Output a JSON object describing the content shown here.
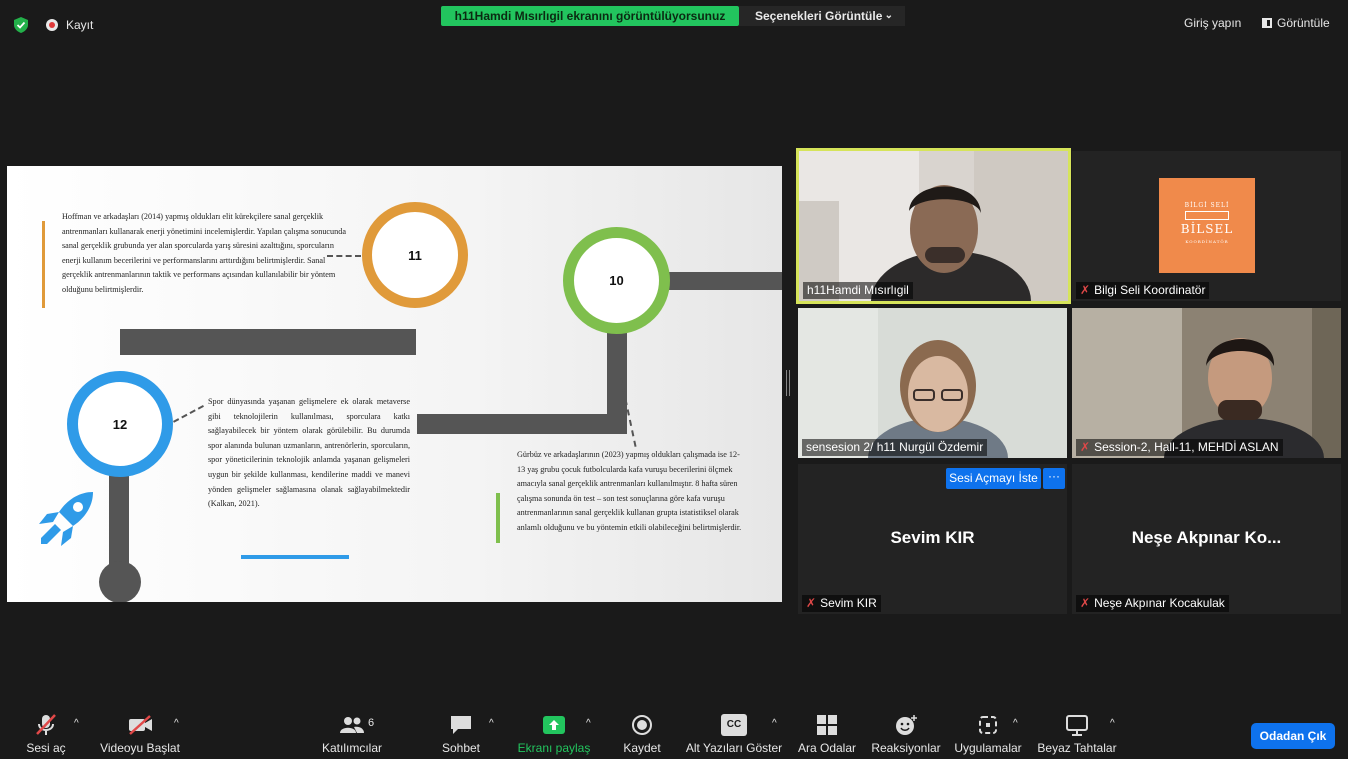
{
  "topbar": {
    "recording_label": "Kayıt",
    "share_banner": "h11Hamdi Mısırlıgil ekranını görüntülüyorsunuz",
    "view_options": "Seçenekleri Görüntüle",
    "login": "Giriş yapın",
    "view": "Görüntüle"
  },
  "slide": {
    "step_11": "11",
    "step_10": "10",
    "step_12": "12",
    "text_11": "Hoffman ve arkadaşları (2014) yapmış oldukları elit kürekçilere sanal gerçeklik antrenmanları kullanarak enerji yönetimini incelemişlerdir. Yapılan çalışma sonucunda sanal gerçeklik grubunda yer alan sporcularda yarış süresini azalttığını, sporcuların enerji kullanım becerilerini ve performanslarını arttırdığını belirtmişlerdir. Sanal gerçeklik antrenmanlarının taktik ve performans açısından kullanılabilir bir yöntem olduğunu belirtmişlerdir.",
    "text_12": "Spor dünyasında yaşanan gelişmelere ek olarak metaverse gibi teknolojilerin kullanılması, sporculara katkı sağlayabilecek bir yöntem olarak görülebilir. Bu durumda spor alanında bulunan uzmanların, antrenörlerin, sporcuların, spor yöneticilerinin teknolojik anlamda yaşanan gelişmeleri uygun bir şekilde kullanması, kendilerine maddi ve manevi yönden gelişmeler sağlamasına olanak sağlayabilmektedir (Kalkan, 2021).",
    "text_10": "Gürbüz ve arkadaşlarının (2023) yapmış oldukları çalışmada ise 12-13 yaş grubu çocuk futbolcularda kafa vuruşu becerilerini ölçmek amacıyla sanal gerçeklik antrenmanları kullanılmıştır. 8 hafta süren çalışma sonunda ön test – son test sonuçlarına göre kafa vuruşu antrenmanlarının sanal gerçeklik kullanan grupta istatistiksel olarak anlamlı olduğunu ve bu yöntemin etkili olabileceğini belirtmişlerdir."
  },
  "participants": [
    {
      "name": "h11Hamdi Mısırlıgil",
      "muted": false,
      "active": true
    },
    {
      "name": "Bilgi Seli Koordinatör",
      "muted": true,
      "logo_top": "BİLGİ SELİ",
      "logo_main": "BİLSEL",
      "logo_sub": "KOORDİNATÖR"
    },
    {
      "name": "sensesion 2/ h11 Nurgül Özdemir",
      "muted": false
    },
    {
      "name": "Session-2, Hall-11, MEHDİ ASLAN",
      "muted": true
    },
    {
      "name": "Sevim KIR",
      "display": "Sevim KIR",
      "muted": true
    },
    {
      "name": "Neşe Akpınar Kocakulak",
      "display": "Neşe Akpınar Ko...",
      "muted": true
    }
  ],
  "ask_unmute": "Sesi Açmayı İste",
  "more": "···",
  "toolbar": {
    "audio": "Sesi aç",
    "video": "Videoyu Başlat",
    "participants": "Katılımcılar",
    "participants_count": "6",
    "chat": "Sohbet",
    "share": "Ekranı paylaş",
    "record": "Kaydet",
    "captions": "Alt Yazıları Göster",
    "breakout": "Ara Odalar",
    "reactions": "Reaksiyonlar",
    "apps": "Uygulamalar",
    "whiteboard": "Beyaz Tahtalar",
    "leave": "Odadan Çık",
    "cc": "CC"
  },
  "colors": {
    "accent_blue": "#0e72ed",
    "share_green": "#22c55e",
    "ring_orange": "#e09a3a",
    "ring_green": "#7fbf4d",
    "ring_blue": "#2f9be8",
    "active_border": "#d6e45a",
    "muted_red": "#e04848"
  }
}
